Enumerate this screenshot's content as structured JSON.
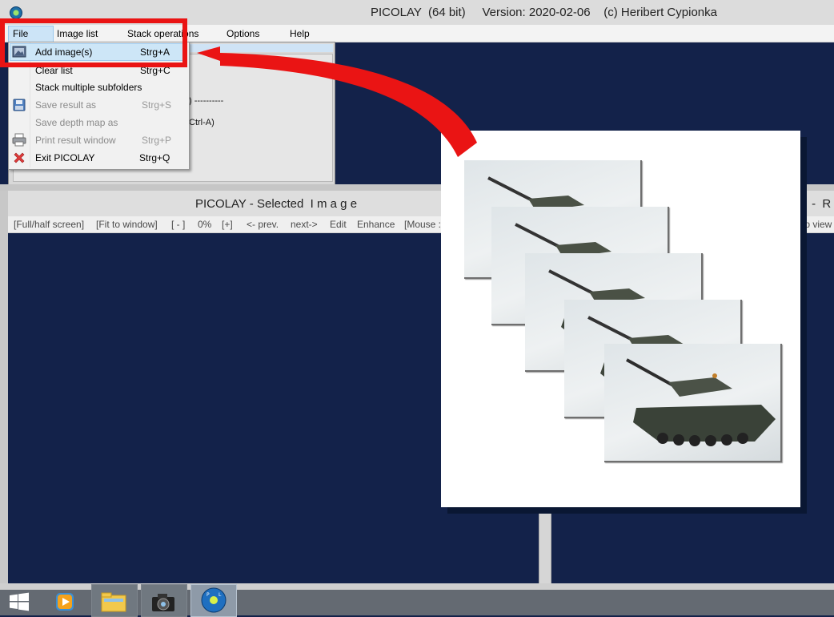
{
  "window": {
    "title": "PICOLAY  (64 bit)     Version: 2020-02-06    (c) Heribert Cypionka"
  },
  "menubar": {
    "items": [
      "File",
      "Image list",
      "Stack operations",
      "Options",
      "Help"
    ]
  },
  "file_menu": {
    "items": [
      {
        "label": "Add image(s)",
        "shortcut": "Strg+A",
        "enabled": true,
        "icon": "image-icon"
      },
      {
        "label": "Clear list",
        "shortcut": "Strg+C",
        "enabled": true,
        "icon": ""
      },
      {
        "label": "Stack multiple subfolders",
        "shortcut": "",
        "enabled": true,
        "icon": ""
      },
      {
        "label": "Save result as",
        "shortcut": "Strg+S",
        "enabled": false,
        "icon": "floppy-disk-icon"
      },
      {
        "label": "Save depth map as",
        "shortcut": "",
        "enabled": false,
        "icon": ""
      },
      {
        "label": "Print result window",
        "shortcut": "Strg+P",
        "enabled": false,
        "icon": "printer-icon"
      },
      {
        "label": "Exit PICOLAY",
        "shortcut": "Strg+Q",
        "enabled": true,
        "icon": "red-x-icon"
      }
    ]
  },
  "upper_panel": {
    "partial_text_1": ") ----------",
    "partial_text_2": "Ctrl-A)"
  },
  "lower_window": {
    "title": "PICOLAY - Selected  I m a g e",
    "title_right": "Y  -  R",
    "toolbar": [
      "[Full/half screen]",
      "[Fit to window]",
      "[ - ]",
      "0%",
      "[+]",
      "<- prev.",
      "next->",
      "Edit",
      "Enhance",
      "[Mouse :",
      "lip view"
    ]
  },
  "taskbar": {
    "buttons": [
      "windows-start-icon",
      "media-player-icon",
      "file-explorer-icon",
      "camera-app-icon",
      "picolay-app-icon"
    ]
  },
  "colors": {
    "workspace": "#13224a",
    "highlight_red": "#ea1414",
    "menu_highlight": "#cde6f7"
  }
}
